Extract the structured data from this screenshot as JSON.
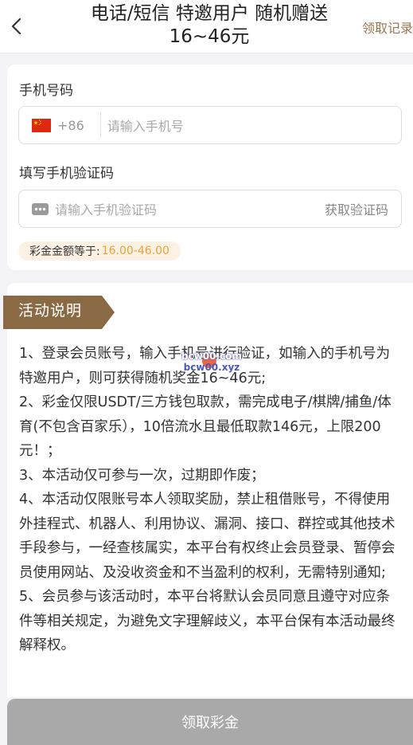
{
  "header": {
    "title": "电话/短信 特邀用户 随机赠送16~46元",
    "record_link": "领取记录"
  },
  "icons": {
    "back": "chevron-left-icon",
    "flag": "china-flag-icon",
    "sms": "message-dots-icon"
  },
  "form": {
    "phone_label": "手机号码",
    "country_code": "+86",
    "phone_placeholder": "请输入手机号",
    "code_label": "填写手机验证码",
    "code_placeholder": "请输入手机验证码",
    "get_code_label": "获取验证码",
    "amount_label": "彩金金额等于:",
    "amount_value": "16.00-46.00"
  },
  "activity": {
    "title": "活动说明",
    "rules": [
      "1、登录会员账号，输入手机号进行验证，如输入的手机号为特邀用户，则可获得随机奖金16~46元;",
      "2、彩金仅限USDT/三方钱包取款，需完成电子/棋牌/捕鱼/体育(不包含百家乐），10倍流水且最低取款146元，上限200元！；",
      "3、本活动仅可参与一次，过期即作废；",
      "4、本活动仅限账号本人领取奖励，禁止租借账号，不得使用外挂程式、机器人、利用协议、漏洞、接口、群控或其他技术手段参与，一经查核属实，本平台有权终止会员登录、暂停会员使用网站、及没收资金和不当盈利的权利，无需特别通知;",
      "5、会员参与该活动时，本平台将默认会员同意且遵守对应条件等相关规定，为避免文字理解歧义，本平台保有本活动最终解释权。"
    ]
  },
  "watermark": {
    "line1": "bcw00.com",
    "line2": "bcw00.xyz"
  },
  "footer": {
    "claim_label": "领取彩金"
  },
  "colors": {
    "accent_gold": "#9a7750",
    "amount_orange": "#e8a23b",
    "ribbon_brown": "#8a6a45",
    "button_disabled": "#a9a9a9"
  }
}
